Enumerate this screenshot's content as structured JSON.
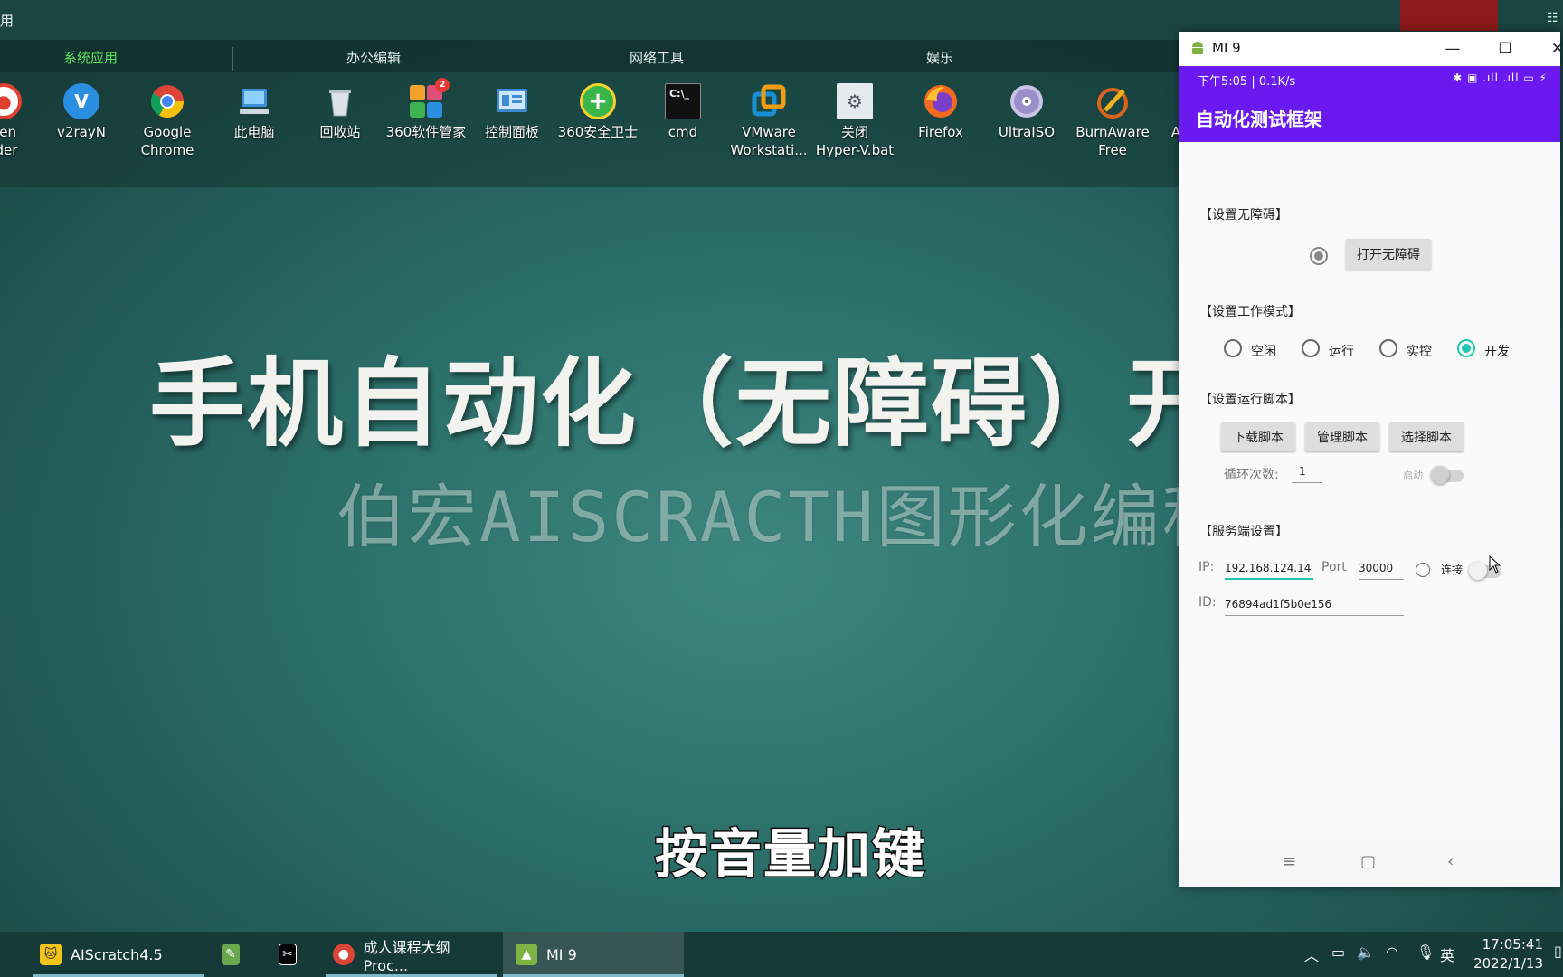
{
  "desktop": {
    "top_label": "用",
    "fences": [
      {
        "label": "系统应用",
        "active": true
      },
      {
        "label": "办公编辑",
        "active": false
      },
      {
        "label": "网络工具",
        "active": false
      },
      {
        "label": "娱乐",
        "active": false
      }
    ],
    "icons": [
      {
        "label": "een\nrder",
        "icon": "recorder-icon",
        "color": "#e0412f"
      },
      {
        "label": "v2rayN",
        "icon": "v2rayn-icon",
        "color": "#2a8fe0"
      },
      {
        "label": "Google\nChrome",
        "icon": "chrome-icon",
        "color": "#e8a20c"
      },
      {
        "label": "此电脑",
        "icon": "computer-icon",
        "color": "#3b8fd6"
      },
      {
        "label": "回收站",
        "icon": "recycle-bin-icon",
        "color": "#b9c5cc"
      },
      {
        "label": "360软件管家",
        "icon": "360-software-icon",
        "color": "#e04f7a",
        "badge": "2"
      },
      {
        "label": "控制面板",
        "icon": "control-panel-icon",
        "color": "#3f8bd1"
      },
      {
        "label": "360安全卫士",
        "icon": "360-security-icon",
        "color": "#39b54a"
      },
      {
        "label": "cmd",
        "icon": "cmd-icon",
        "color": "#111111"
      },
      {
        "label": "VMware\nWorkstati...",
        "icon": "vmware-icon",
        "color": "#1a8fd6"
      },
      {
        "label": "关闭\nHyper-V.bat",
        "icon": "bat-file-icon",
        "color": "#cfd6dc"
      },
      {
        "label": "Firefox",
        "icon": "firefox-icon",
        "color": "#f26b1d"
      },
      {
        "label": "UltraISO",
        "icon": "ultraiso-icon",
        "color": "#9a8fc9"
      },
      {
        "label": "BurnAware\nFree",
        "icon": "burnaware-icon",
        "color": "#d9641e"
      },
      {
        "label": "A",
        "icon": "partial-icon",
        "color": "#2a6f6a"
      }
    ],
    "headline": "手机自动化（无障碍）开",
    "subline": "伯宏AISCRACTH图形化编程",
    "caption": "按音量加键"
  },
  "taskbar": {
    "items": [
      {
        "label": "AIScratch4.5",
        "icon": "aiscratch-icon"
      },
      {
        "label": "",
        "icon": "paint-icon"
      },
      {
        "label": "",
        "icon": "capcut-icon"
      },
      {
        "label": "成人课程大纲 Proc...",
        "icon": "chrome-icon"
      },
      {
        "label": "MI 9",
        "icon": "android-icon"
      }
    ],
    "ime": "英",
    "clock_time": "17:05:41",
    "clock_date": "2022/1/13"
  },
  "phone": {
    "window_title": "MI 9",
    "status_left": "下午5:05 | 0.1K/s",
    "status_right": "✱ ▣ .ıll .ıll ▭ ⚡",
    "app_title": "自动化测试框架",
    "sec_accessibility": "【设置无障碍】",
    "open_accessibility": "打开无障碍",
    "sec_mode": "【设置工作模式】",
    "modes": [
      {
        "label": "空闲",
        "on": false
      },
      {
        "label": "运行",
        "on": false
      },
      {
        "label": "实控",
        "on": false
      },
      {
        "label": "开发",
        "on": true
      }
    ],
    "sec_script": "【设置运行脚本】",
    "script_buttons": [
      "下载脚本",
      "管理脚本",
      "选择脚本"
    ],
    "loop_label": "循环次数:",
    "loop_value": "1",
    "start_label": "启动",
    "sec_server": "【服务端设置】",
    "ip_label": "IP:",
    "ip_value": "192.168.124.14",
    "port_label": "Port",
    "port_value": "30000",
    "connect_label": "连接",
    "id_label": "ID:",
    "id_value": "76894ad1f5b0e156"
  }
}
